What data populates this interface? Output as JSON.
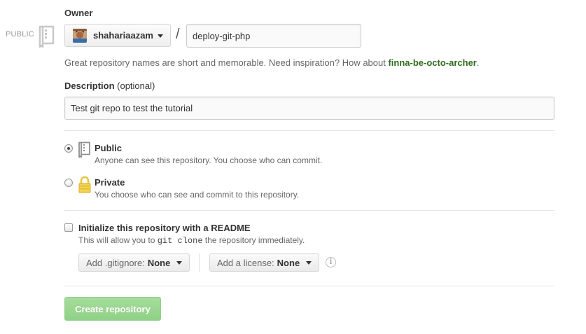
{
  "visibility_badge": "PUBLIC",
  "owner": {
    "label": "Owner",
    "name": "shahariaazam"
  },
  "separator": "/",
  "repo_name": {
    "value": "deploy-git-php"
  },
  "help": {
    "text": "Great repository names are short and memorable. Need inspiration? How about ",
    "suggestion": "finna-be-octo-archer",
    "end": "."
  },
  "description": {
    "label": "Description",
    "optional": "(optional)",
    "value": "Test git repo to test the tutorial"
  },
  "visibility": {
    "selected": "public",
    "public": {
      "title": "Public",
      "desc": "Anyone can see this repository. You choose who can commit."
    },
    "private": {
      "title": "Private",
      "desc": "You choose who can see and commit to this repository."
    }
  },
  "init": {
    "checked": false,
    "title": "Initialize this repository with a README",
    "desc_before": "This will allow you to ",
    "desc_code": "git clone",
    "desc_after": " the repository immediately."
  },
  "gitignore": {
    "label": "Add .gitignore:",
    "value": "None"
  },
  "license": {
    "label": "Add a license:",
    "value": "None"
  },
  "info_glyph": "i",
  "create_button": "Create repository",
  "colors": {
    "suggestion": "#2f6c1c",
    "create_button": "#95d58c",
    "lock_icon": "#e8c23a"
  },
  "icons": [
    "repo-icon",
    "lock-icon",
    "info-icon",
    "caret-down-icon"
  ]
}
